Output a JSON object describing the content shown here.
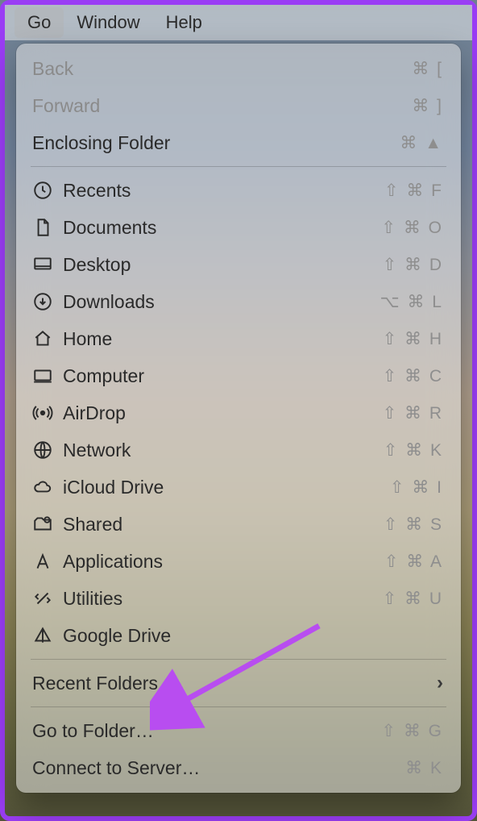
{
  "menubar": {
    "items": [
      {
        "label": "Go",
        "active": true
      },
      {
        "label": "Window",
        "active": false
      },
      {
        "label": "Help",
        "active": false
      }
    ]
  },
  "menu": {
    "group_nav": [
      {
        "label": "Back",
        "shortcut": "⌘ [",
        "disabled": true
      },
      {
        "label": "Forward",
        "shortcut": "⌘ ]",
        "disabled": true
      },
      {
        "label": "Enclosing Folder",
        "shortcut": "⌘ ▲",
        "disabled": false
      }
    ],
    "group_places": [
      {
        "icon": "clock-icon",
        "label": "Recents",
        "shortcut": "⇧ ⌘ F"
      },
      {
        "icon": "document-icon",
        "label": "Documents",
        "shortcut": "⇧ ⌘ O"
      },
      {
        "icon": "desktop-icon",
        "label": "Desktop",
        "shortcut": "⇧ ⌘ D"
      },
      {
        "icon": "download-icon",
        "label": "Downloads",
        "shortcut": "⌥ ⌘ L"
      },
      {
        "icon": "home-icon",
        "label": "Home",
        "shortcut": "⇧ ⌘ H"
      },
      {
        "icon": "computer-icon",
        "label": "Computer",
        "shortcut": "⇧ ⌘ C"
      },
      {
        "icon": "airdrop-icon",
        "label": "AirDrop",
        "shortcut": "⇧ ⌘ R"
      },
      {
        "icon": "network-icon",
        "label": "Network",
        "shortcut": "⇧ ⌘ K"
      },
      {
        "icon": "icloud-icon",
        "label": "iCloud Drive",
        "shortcut": "⇧ ⌘ I"
      },
      {
        "icon": "shared-icon",
        "label": "Shared",
        "shortcut": "⇧ ⌘ S"
      },
      {
        "icon": "applications-icon",
        "label": "Applications",
        "shortcut": "⇧ ⌘ A"
      },
      {
        "icon": "utilities-icon",
        "label": "Utilities",
        "shortcut": "⇧ ⌘ U"
      },
      {
        "icon": "gdrive-icon",
        "label": "Google Drive",
        "shortcut": ""
      }
    ],
    "recent_folders": {
      "label": "Recent Folders"
    },
    "group_bottom": [
      {
        "label": "Go to Folder…",
        "shortcut": "⇧ ⌘ G"
      },
      {
        "label": "Connect to Server…",
        "shortcut": "⌘ K"
      }
    ]
  },
  "annotation": {
    "arrow_color": "#b84df0"
  }
}
